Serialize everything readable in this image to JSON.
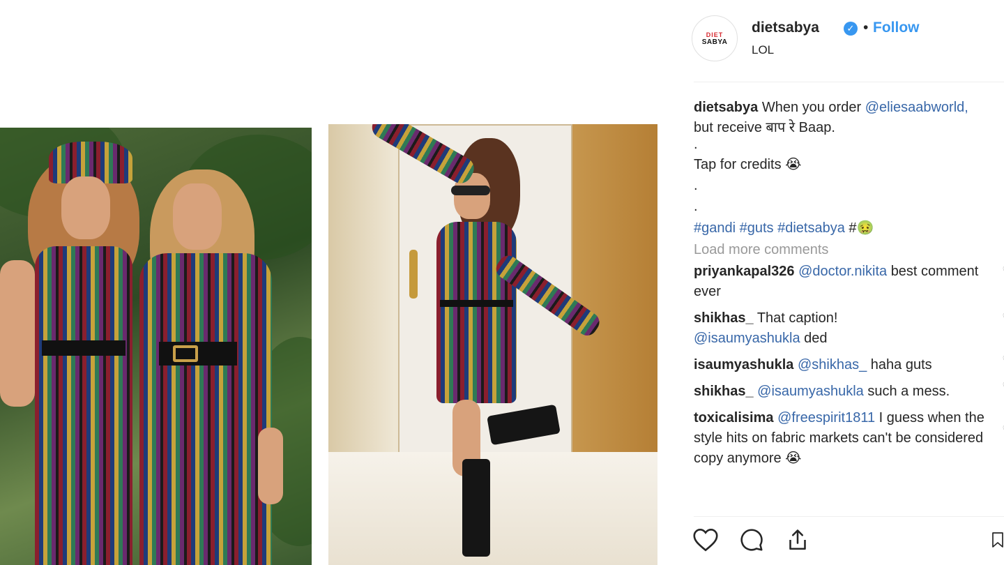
{
  "post": {
    "author": "dietsabya",
    "location": "LOL",
    "follow_label": "Follow",
    "separator": "•",
    "verified_mark": "✓",
    "avatar_text": {
      "top": "DIET",
      "bottom": "SABYA"
    }
  },
  "caption": {
    "user": "dietsabya",
    "text_1": "When you order",
    "mention": "@eliesaabworld,",
    "text_2": "but receive बाप रे Baap.",
    "line_dot": ".",
    "credits": "Tap for credits 😭",
    "hashtags": "#gandi #guts #dietsabya",
    "hashtag_end": "#🤢"
  },
  "load_more_label": "Load more comments",
  "comments": [
    {
      "user": "priyankapal326",
      "mention": "@doctor.nikita",
      "text": "best comment ever"
    },
    {
      "user": "shikhas_",
      "text": "That caption!",
      "mention": "@isaumyashukla",
      "text_after": "ded"
    },
    {
      "user": "isaumyashukla",
      "mention": "@shikhas_",
      "text": "haha guts"
    },
    {
      "user": "shikhas_",
      "mention": "@isaumyashukla",
      "text": "such a mess."
    },
    {
      "user": "toxicalisima",
      "mention": "@freespirit1811",
      "text": "I guess when the style hits on fabric markets can't be considered copy anymore 😭"
    }
  ],
  "icons": {
    "like": "heart-icon",
    "comment": "comment-icon",
    "share": "share-icon",
    "save": "bookmark-icon",
    "comment_like": "heart-outline-icon",
    "verified": "verified-badge-icon"
  },
  "colors": {
    "link": "#3897f0",
    "mention": "#3867a8",
    "muted": "#999999",
    "text": "#262626"
  }
}
